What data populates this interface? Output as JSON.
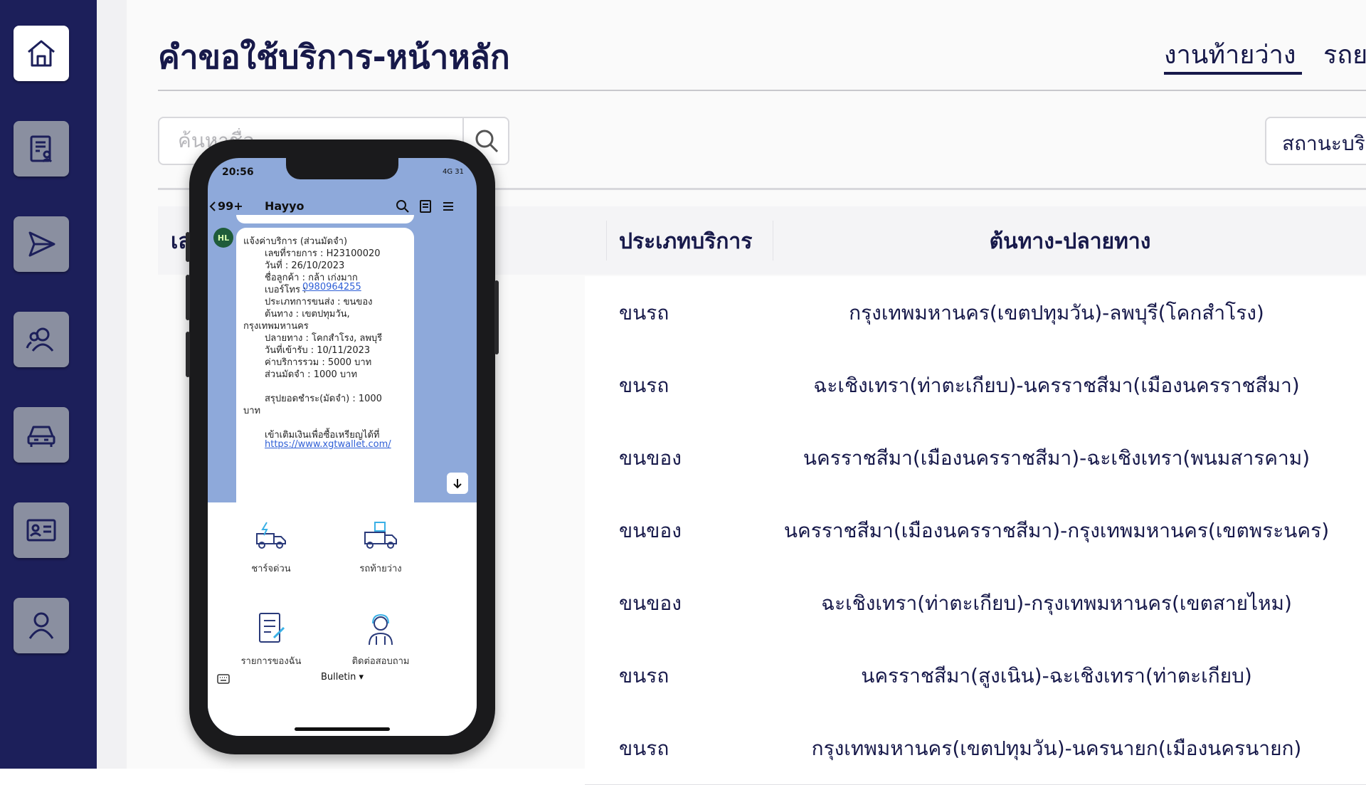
{
  "sidebar": {
    "items": [
      {
        "name": "home-icon"
      },
      {
        "name": "document-icon"
      },
      {
        "name": "send-icon"
      },
      {
        "name": "users-icon"
      },
      {
        "name": "car-icon"
      },
      {
        "name": "id-card-icon"
      },
      {
        "name": "user-icon"
      }
    ]
  },
  "header": {
    "title": "คำขอใช้บริการ-หน้าหลัก",
    "tabs": [
      "งานท้ายว่าง",
      "รถย"
    ]
  },
  "filters": {
    "search_placeholder": "ค้นหาชื่อ",
    "status_label": "สถานะบริ"
  },
  "table": {
    "columns": [
      "เล",
      "ประเภทบริการ",
      "ต้นทาง-ปลายทาง"
    ],
    "rows": [
      {
        "type": "ขนรถ",
        "route": "กรุงเทพมหานคร(เขตปทุมวัน)-ลพบุรี(โคกสำโรง)"
      },
      {
        "type": "ขนรถ",
        "route": "ฉะเชิงเทรา(ท่าตะเกียบ)-นครราชสีมา(เมืองนครราชสีมา)"
      },
      {
        "type": "ขนของ",
        "route": "นครราชสีมา(เมืองนครราชสีมา)-ฉะเชิงเทรา(พนมสารคาม)"
      },
      {
        "type": "ขนของ",
        "route": "นครราชสีมา(เมืองนครราชสีมา)-กรุงเทพมหานคร(เขตพระนคร)"
      },
      {
        "type": "ขนของ",
        "route": "ฉะเชิงเทรา(ท่าตะเกียบ)-กรุงเทพมหานคร(เขตสายไหม)"
      },
      {
        "type": "ขนรถ",
        "route": "นครราชสีมา(สูงเนิน)-ฉะเชิงเทรา(ท่าตะเกียบ)"
      },
      {
        "type": "ขนรถ",
        "route": "กรุงเทพมหานคร(เขตปทุมวัน)-นครนายก(เมืองนครนายก)"
      }
    ]
  },
  "phone": {
    "status_time": "20:56",
    "status_right": "4G 31",
    "back_count": "99+",
    "chat_name": "Hayyo",
    "avatar_text": "HL",
    "message_lines": [
      "แจ้งค่าบริการ (ส่วนมัดจำ)",
      "เลขที่รายการ : H23100020",
      "วันที่ : 26/10/2023",
      "ชื่อลูกค้า : กล้า เก่งมาก",
      "เบอร์โทร : ",
      "0980964255",
      "ประเภทการขนส่ง : ขนของ",
      "ต้นทาง : เขตปทุมวัน,",
      "กรุงเทพมหานคร",
      "ปลายทาง : โคกสำโรง, ลพบุรี",
      "วันที่เข้ารับ : 10/11/2023",
      "ค่าบริการรวม :  5000 บาท",
      "ส่วนมัดจำ : 1000 บาท",
      "สรุปยอดชำระ(มัดจำ) : 1000",
      "บาท",
      "เข้าเติมเงินเพื่อซื้อเหรียญได้ที่",
      "https://www.xgtwallet.com/"
    ],
    "menu": [
      {
        "label": "ชาร์จด่วน",
        "icon": "lightning-truck-icon"
      },
      {
        "label": "รถท้ายว่าง",
        "icon": "delivery-truck-icon"
      },
      {
        "label": "รายการของฉัน",
        "icon": "checklist-icon"
      },
      {
        "label": "ติดต่อสอบถาม",
        "icon": "support-agent-icon"
      }
    ],
    "bulletin": "Bulletin ▾"
  }
}
